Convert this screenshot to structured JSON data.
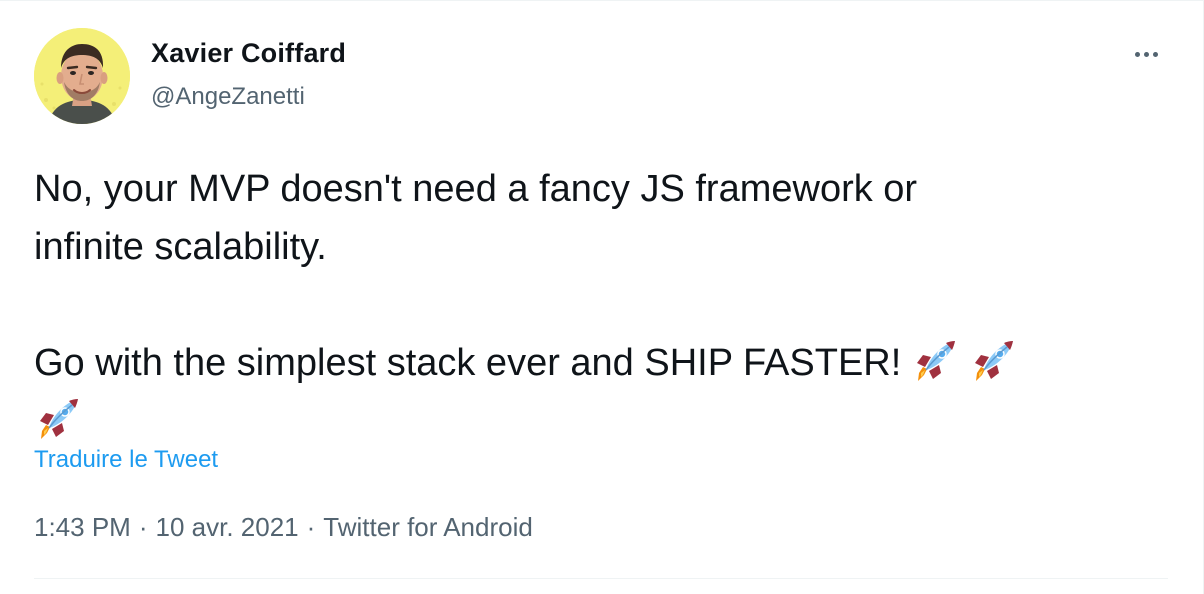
{
  "tweet": {
    "author_name": "Xavier Coiffard",
    "author_handle": "@AngeZanetti",
    "text_lines": [
      "No, your MVP doesn't need a fancy JS framework or",
      "infinite scalability.",
      "",
      "Go with the simplest stack ever and SHIP FASTER!"
    ],
    "emoji": [
      "rocket",
      "rocket",
      "rocket"
    ],
    "translate_label": "Traduire le Tweet",
    "time": "1:43 PM",
    "date": "10 avr. 2021",
    "source": "Twitter for Android",
    "separator": "·"
  },
  "icons": {
    "avatar": "profile-photo",
    "more": "more-options-icon",
    "rocket": "rocket-emoji"
  },
  "colors": {
    "text": "#0f1419",
    "secondary": "#536471",
    "link": "#1d9bf0",
    "divider": "#eff3f4",
    "avatar_bg": "#f4ef78"
  }
}
